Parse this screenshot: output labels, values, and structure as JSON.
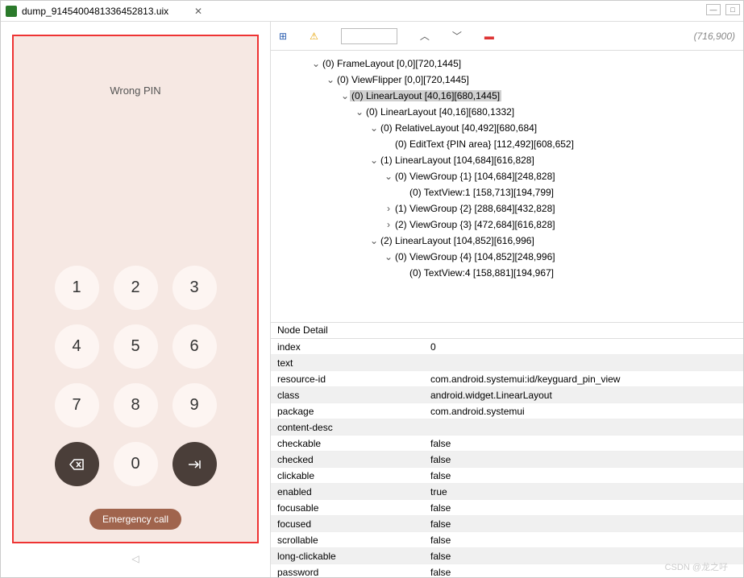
{
  "titlebar": {
    "filename": "dump_9145400481336452813.uix"
  },
  "toolbar": {
    "coord": "(716,900)"
  },
  "device": {
    "message": "Wrong PIN",
    "keys": [
      "1",
      "2",
      "3",
      "4",
      "5",
      "6",
      "7",
      "8",
      "9",
      "⌫",
      "0",
      "→|"
    ],
    "emergency": "Emergency call"
  },
  "tree": [
    {
      "d": 0,
      "t": "v",
      "label": "(0) FrameLayout [0,0][720,1445]"
    },
    {
      "d": 1,
      "t": "v",
      "label": "(0) ViewFlipper [0,0][720,1445]"
    },
    {
      "d": 2,
      "t": "v",
      "label": "(0) LinearLayout [40,16][680,1445]",
      "sel": true
    },
    {
      "d": 3,
      "t": "v",
      "label": "(0) LinearLayout [40,16][680,1332]"
    },
    {
      "d": 4,
      "t": "v",
      "label": "(0) RelativeLayout [40,492][680,684]"
    },
    {
      "d": 5,
      "t": "",
      "label": "(0) EditText {PIN area} [112,492][608,652]"
    },
    {
      "d": 4,
      "t": "v",
      "label": "(1) LinearLayout [104,684][616,828]"
    },
    {
      "d": 5,
      "t": "v",
      "label": "(0) ViewGroup {1} [104,684][248,828]"
    },
    {
      "d": 6,
      "t": "",
      "label": "(0) TextView:1 [158,713][194,799]"
    },
    {
      "d": 5,
      "t": ">",
      "label": "(1) ViewGroup {2} [288,684][432,828]"
    },
    {
      "d": 5,
      "t": ">",
      "label": "(2) ViewGroup {3} [472,684][616,828]"
    },
    {
      "d": 4,
      "t": "v",
      "label": "(2) LinearLayout [104,852][616,996]"
    },
    {
      "d": 5,
      "t": "v",
      "label": "(0) ViewGroup {4} [104,852][248,996]"
    },
    {
      "d": 6,
      "t": "",
      "label": "(0) TextView:4 [158,881][194,967]"
    }
  ],
  "detailhdr": "Node Detail",
  "detail": [
    {
      "k": "index",
      "v": "0"
    },
    {
      "k": "text",
      "v": ""
    },
    {
      "k": "resource-id",
      "v": "com.android.systemui:id/keyguard_pin_view"
    },
    {
      "k": "class",
      "v": "android.widget.LinearLayout"
    },
    {
      "k": "package",
      "v": "com.android.systemui"
    },
    {
      "k": "content-desc",
      "v": ""
    },
    {
      "k": "checkable",
      "v": "false"
    },
    {
      "k": "checked",
      "v": "false"
    },
    {
      "k": "clickable",
      "v": "false"
    },
    {
      "k": "enabled",
      "v": "true"
    },
    {
      "k": "focusable",
      "v": "false"
    },
    {
      "k": "focused",
      "v": "false"
    },
    {
      "k": "scrollable",
      "v": "false"
    },
    {
      "k": "long-clickable",
      "v": "false"
    },
    {
      "k": "password",
      "v": "false"
    }
  ],
  "watermark": "CSDN @龙之吇"
}
